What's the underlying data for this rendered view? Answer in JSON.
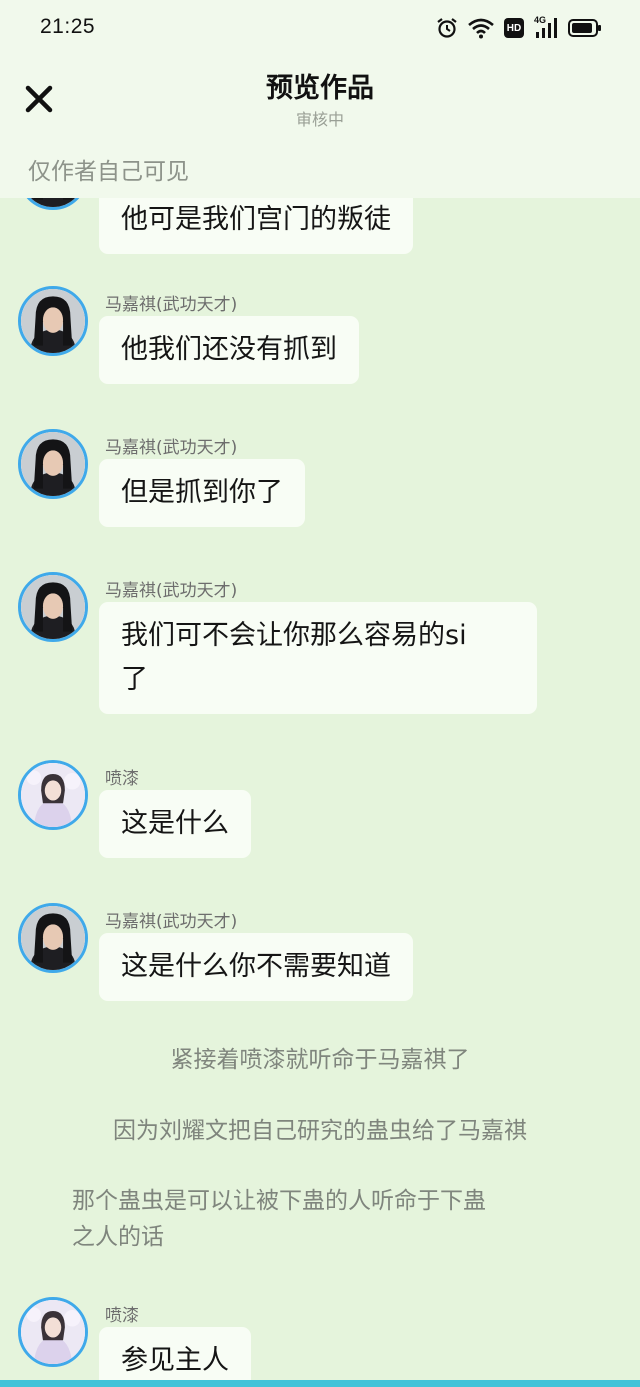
{
  "status_bar": {
    "time": "21:25",
    "icons": [
      "alarm-icon",
      "wifi-icon",
      "hd-icon",
      "signal-4g-icon",
      "battery-icon"
    ],
    "hd_label": "HD",
    "network_label": "4G"
  },
  "header": {
    "title": "预览作品",
    "subtitle": "审核中",
    "visibility_note": "仅作者自己可见",
    "close_icon": "close-icon"
  },
  "messages": [
    {
      "speaker": "",
      "text": "他可是我们宫门的叛徒",
      "avatar": "male-avatar"
    },
    {
      "speaker": "马嘉祺(武功天才)",
      "text": "他我们还没有抓到",
      "avatar": "male-avatar"
    },
    {
      "speaker": "马嘉祺(武功天才)",
      "text": "但是抓到你了",
      "avatar": "male-avatar"
    },
    {
      "speaker": "马嘉祺(武功天才)",
      "text": "我们可不会让你那么容易的si了",
      "line1": "我们可不会让你那么容易的si",
      "line2": "了",
      "avatar": "male-avatar"
    },
    {
      "speaker": "喷漆",
      "text": "这是什么",
      "avatar": "female-avatar"
    },
    {
      "speaker": "马嘉祺(武功天才)",
      "text": "这是什么你不需要知道",
      "avatar": "male-avatar"
    },
    {
      "speaker": "喷漆",
      "text": "参见主人",
      "avatar": "female-avatar"
    }
  ],
  "narrations": [
    "紧接着喷漆就听命于马嘉祺了",
    "因为刘耀文把自己研究的蛊虫给了马嘉祺",
    "那个蛊虫是可以让被下蛊的人听命于下蛊之人的话"
  ],
  "narration_lines": {
    "n3_line1": "那个蛊虫是可以让被下蛊的人听命于下蛊",
    "n3_line2": "之人的话"
  },
  "colors": {
    "background": "#e5f4dc",
    "header": "#f1f9ec",
    "bubble": "#f8fdf5",
    "avatar_ring": "#3fa9ea",
    "bottom_bar": "#41c3d8"
  }
}
